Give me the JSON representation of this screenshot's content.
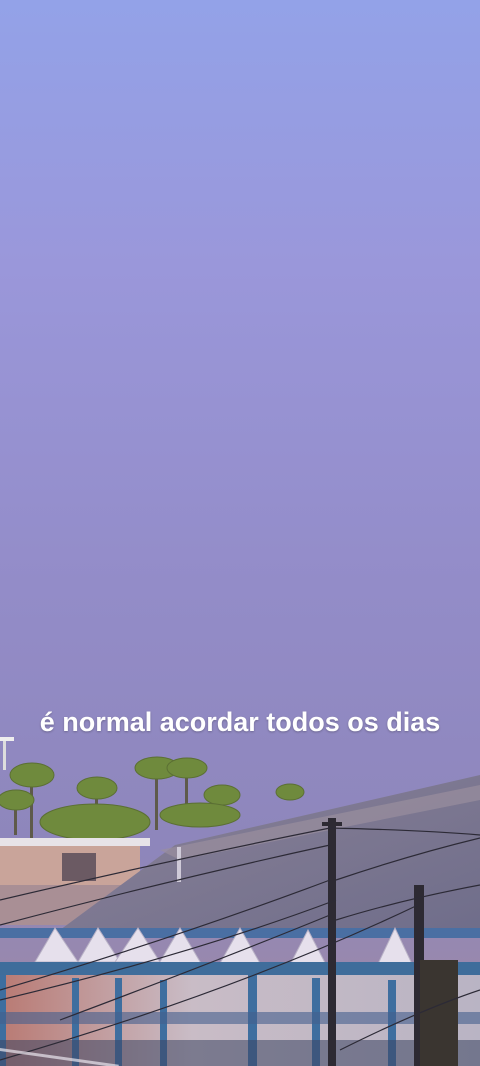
{
  "caption": {
    "text": "é normal acordar todos os dias"
  },
  "scene": {
    "description_colors": {
      "sky_top": "#8fa0e6",
      "sky_mid": "#9b93cf",
      "sky_bottom": "#8a86bd",
      "roof": "#7c7895",
      "wall": "#c7bcc8",
      "wall_blue": "#3d6f9e",
      "palm": "#6e8a3c"
    }
  }
}
